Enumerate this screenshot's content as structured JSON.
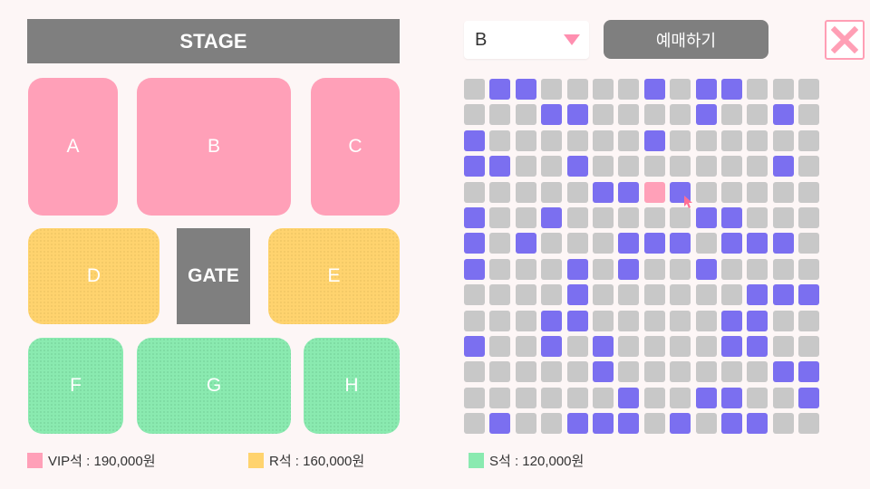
{
  "stage": {
    "label": "STAGE"
  },
  "gate": {
    "label": "GATE"
  },
  "zones": {
    "A": "A",
    "B": "B",
    "C": "C",
    "D": "D",
    "E": "E",
    "F": "F",
    "G": "G",
    "H": "H"
  },
  "colors": {
    "vip": "#ffa0b8",
    "r": "#ffd36e",
    "s": "#8aeab0",
    "seat_available": "#c8c8c8",
    "seat_reserved": "#7b6ff0",
    "seat_selected": "#ffa0b8"
  },
  "legend": {
    "vip": "VIP석 : 190,000원",
    "r": "R석 : 160,000원",
    "s": "S석 : 120,000원"
  },
  "zone_select": {
    "value": "B"
  },
  "reserve_button": {
    "label": "예매하기"
  },
  "close_button": {
    "icon": "close-icon"
  },
  "seat_map": {
    "legend_key": "0=available 1=reserved 2=selected",
    "rows": [
      [
        0,
        1,
        1,
        0,
        0,
        0,
        0,
        1,
        0,
        1,
        1,
        0,
        0,
        0
      ],
      [
        0,
        0,
        0,
        1,
        1,
        0,
        0,
        0,
        0,
        1,
        0,
        0,
        1,
        0
      ],
      [
        1,
        0,
        0,
        0,
        0,
        0,
        0,
        1,
        0,
        0,
        0,
        0,
        0,
        0
      ],
      [
        1,
        1,
        0,
        0,
        1,
        0,
        0,
        0,
        0,
        0,
        0,
        0,
        1,
        0
      ],
      [
        0,
        0,
        0,
        0,
        0,
        1,
        1,
        2,
        1,
        0,
        0,
        0,
        0,
        0
      ],
      [
        1,
        0,
        0,
        1,
        0,
        0,
        0,
        0,
        0,
        1,
        1,
        0,
        0,
        0
      ],
      [
        1,
        0,
        1,
        0,
        0,
        0,
        1,
        1,
        1,
        0,
        1,
        1,
        1,
        0
      ],
      [
        1,
        0,
        0,
        0,
        1,
        0,
        1,
        0,
        0,
        1,
        0,
        0,
        0,
        0
      ],
      [
        0,
        0,
        0,
        0,
        1,
        0,
        0,
        0,
        0,
        0,
        0,
        1,
        1,
        1
      ],
      [
        0,
        0,
        0,
        1,
        1,
        0,
        0,
        0,
        0,
        0,
        1,
        1,
        0,
        0
      ],
      [
        1,
        0,
        0,
        1,
        0,
        1,
        0,
        0,
        0,
        0,
        1,
        1,
        0,
        0
      ],
      [
        0,
        0,
        0,
        0,
        0,
        1,
        0,
        0,
        0,
        0,
        0,
        0,
        1,
        1
      ],
      [
        0,
        0,
        0,
        0,
        0,
        0,
        1,
        0,
        0,
        1,
        1,
        0,
        0,
        1
      ],
      [
        0,
        1,
        0,
        0,
        1,
        1,
        1,
        0,
        1,
        0,
        1,
        1,
        0,
        0
      ]
    ]
  }
}
